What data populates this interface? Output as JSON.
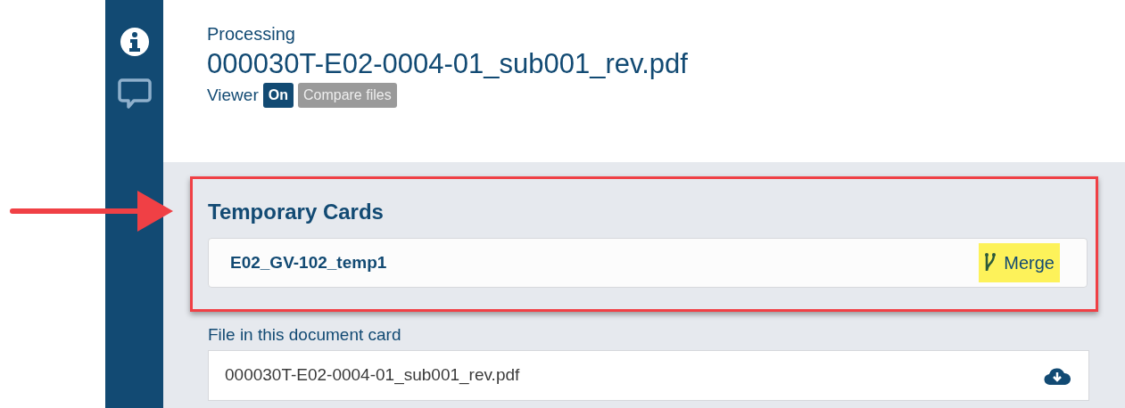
{
  "sidebar": {
    "items": [
      {
        "kind": "info",
        "selected": true
      },
      {
        "kind": "comment",
        "selected": false
      }
    ]
  },
  "header": {
    "status": "Processing",
    "title": "000030T-E02-0004-01_sub001_rev.pdf",
    "viewer_label": "Viewer",
    "viewer_toggle": {
      "label": "On",
      "on": true
    },
    "compare_button": {
      "label": "Compare files",
      "disabled": true
    }
  },
  "temporary_cards": {
    "title": "Temporary Cards",
    "highlighted": true,
    "items": [
      {
        "name": "E02_GV-102_temp1",
        "action": "Merge",
        "highlighted": true
      }
    ]
  },
  "file_section": {
    "label": "File in this document card",
    "file": "000030T-E02-0004-01_sub001_rev.pdf"
  }
}
